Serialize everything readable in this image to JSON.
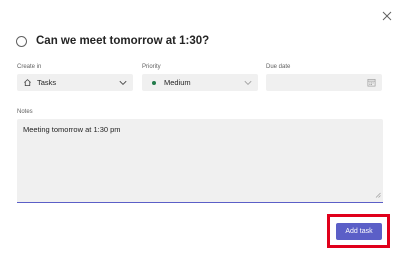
{
  "task": {
    "title": "Can we meet tomorrow at 1:30?"
  },
  "fields": {
    "create_in": {
      "label": "Create in",
      "value": "Tasks",
      "icon": "home-icon"
    },
    "priority": {
      "label": "Priority",
      "value": "Medium",
      "icon": "priority-dot",
      "dot_color": "#237b4b"
    },
    "due_date": {
      "label": "Due date",
      "value": "",
      "icon": "calendar-icon"
    }
  },
  "notes": {
    "label": "Notes",
    "value": "Meeting tomorrow at 1:30 pm"
  },
  "actions": {
    "add_task_label": "Add task",
    "close_icon": "close-icon"
  },
  "colors": {
    "accent": "#5b5fc7",
    "highlight": "#e0001b",
    "field_bg": "#f0f0f0"
  }
}
